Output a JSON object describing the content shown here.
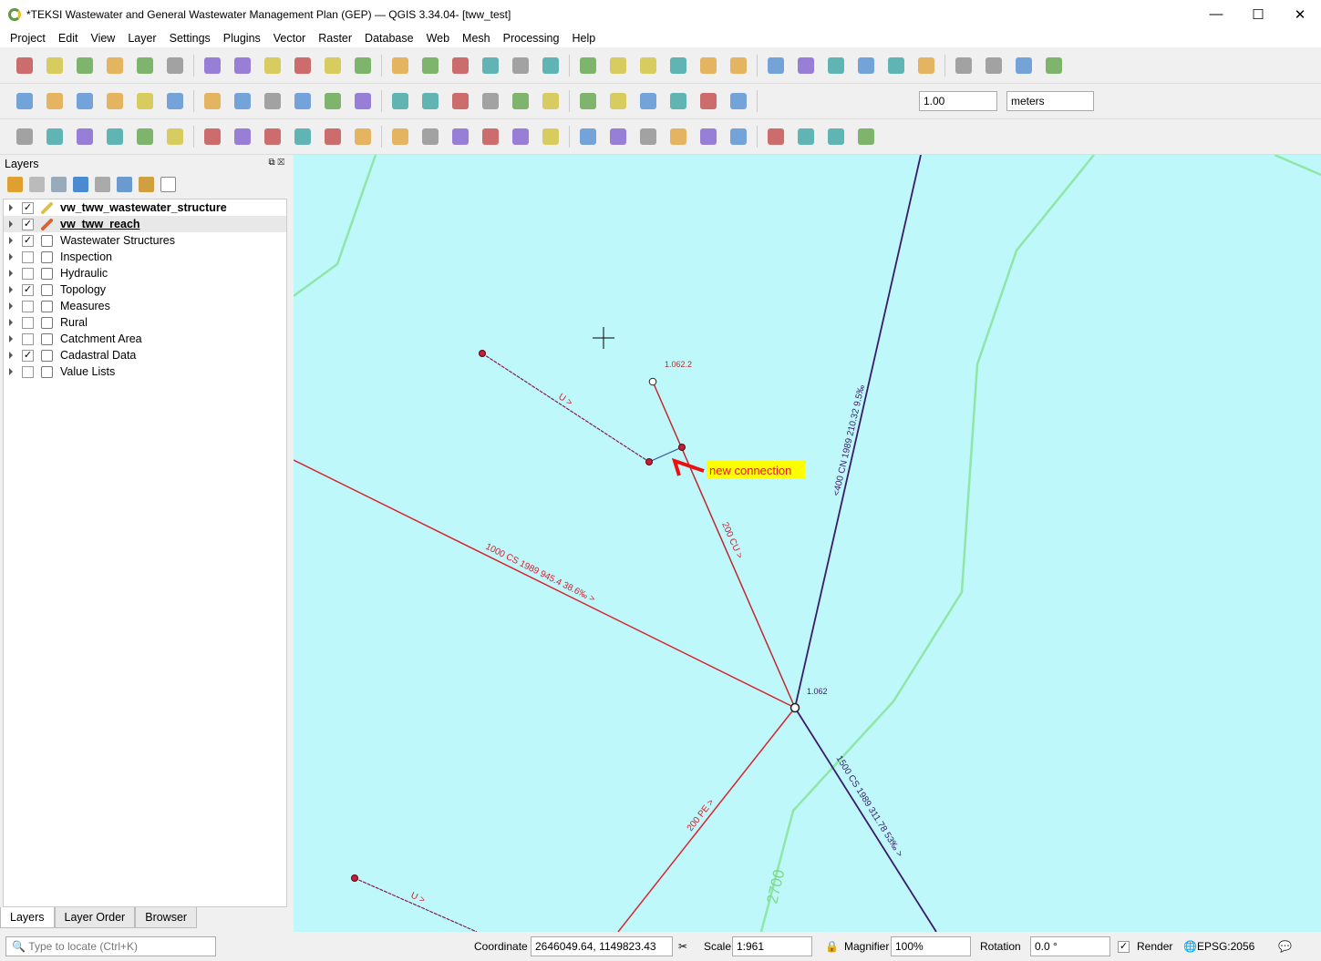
{
  "window": {
    "title": "*TEKSI Wastewater and General Wastewater Management Plan (GEP) — QGIS 3.34.04- [tww_test]",
    "minimize": "—",
    "maximize": "☐",
    "close": "✕"
  },
  "menu": [
    "Project",
    "Edit",
    "View",
    "Layer",
    "Settings",
    "Plugins",
    "Vector",
    "Raster",
    "Database",
    "Web",
    "Mesh",
    "Processing",
    "Help"
  ],
  "toolbar1": [
    "new-project",
    "open-project",
    "save-project",
    "new-print-layout",
    "layout-manager",
    "style-manager",
    "pan",
    "pan-to-selection",
    "zoom-in",
    "zoom-out",
    "zoom-full",
    "zoom-to-selection",
    "zoom-to-layer",
    "zoom-native",
    "zoom-last",
    "zoom-next",
    "new-map-view",
    "new-3d-view",
    "new-bookmark",
    "show-bookmarks",
    "temporal-controller",
    "refresh",
    "select-features",
    "select-by-expression",
    "deselect",
    "select-by-location",
    "identify",
    "attribute-table",
    "processing-toolbox",
    "statistics",
    "open-table",
    "measure",
    "map-tips",
    "locator"
  ],
  "toolbar2": [
    "digitize",
    "toggle-editing",
    "save-edits",
    "add-line",
    "vertex-tool",
    "modify-attributes",
    "delete-selected",
    "cut",
    "copy",
    "paste",
    "undo",
    "redo",
    "label-tool",
    "diagram",
    "pin-label",
    "show-hide-label",
    "move-label",
    "rotate-label",
    "change-label",
    "python-console",
    "help",
    "snapping-magnet",
    "snap-mode",
    "snap-vertex"
  ],
  "toolbar3": [
    "measure-line",
    "add-feature",
    "reshape",
    "split",
    "offset",
    "add-ring",
    "fill-ring",
    "add-part",
    "delete-ring",
    "delete-part",
    "merge",
    "simplify",
    "vertex-editor",
    "align",
    "split-parts",
    "rotate",
    "scale",
    "trim",
    "db-manager",
    "layer-select",
    "db-style",
    "tww-wizard",
    "tww-profile",
    "tww-network",
    "sql",
    "tww-connect",
    "tww-flow",
    "tww-trace"
  ],
  "snapping": {
    "tolerance": "1.00",
    "units": "meters"
  },
  "layers_panel": {
    "title": "Layers",
    "items": [
      {
        "name": "vw_tww_wastewater_structure",
        "checked": true,
        "icon": "pencil-icon",
        "bold": true
      },
      {
        "name": "vw_tww_reach",
        "checked": true,
        "icon": "pencil-icon",
        "bold": true
      },
      {
        "name": "Wastewater Structures",
        "checked": true,
        "icon": "group-icon"
      },
      {
        "name": "Inspection",
        "checked": false,
        "icon": "group-icon"
      },
      {
        "name": "Hydraulic",
        "checked": false,
        "icon": "group-icon"
      },
      {
        "name": "Topology",
        "checked": true,
        "icon": "group-icon"
      },
      {
        "name": "Measures",
        "checked": false,
        "icon": "group-icon"
      },
      {
        "name": "Rural",
        "checked": false,
        "icon": "group-icon"
      },
      {
        "name": "Catchment Area",
        "checked": false,
        "icon": "group-icon"
      },
      {
        "name": "Cadastral Data",
        "checked": true,
        "icon": "group-icon"
      },
      {
        "name": "Value Lists",
        "checked": false,
        "icon": "group-icon"
      }
    ]
  },
  "bottom_tabs": [
    "Layers",
    "Layer Order",
    "Browser"
  ],
  "map": {
    "labels": {
      "node_top": "1.062.2",
      "node_main": "1.062",
      "annotation": "new connection",
      "reach_u1": "U >",
      "reach_u2": "U >",
      "reach_200cu": "200 CU >",
      "reach_400": "<400 CN 1989 210.32 9.5‰",
      "reach_1000": "1000 CS 1989 945.4 38.6‰  >",
      "reach_1500": "1500 CS 1989 311.78 53‰  >",
      "reach_200pe": "200 PE >",
      "contour": "2700"
    },
    "colors": {
      "background": "#bff8fa",
      "reach_red": "#d7262f",
      "reach_purple": "#3a1a6a",
      "contour": "#8fe6a8",
      "annotation_bg": "#ffff00",
      "connection": "#3050a0"
    }
  },
  "statusbar": {
    "locate_placeholder": "Type to locate (Ctrl+K)",
    "coordinate_label": "Coordinate",
    "coordinate": "2646049.64, 1149823.43",
    "scale_label": "Scale",
    "scale": "1:961",
    "magnifier_label": "Magnifier",
    "magnifier": "100%",
    "rotation_label": "Rotation",
    "rotation": "0.0 °",
    "render_label": "Render",
    "render_checked": true,
    "crs": "EPSG:2056"
  }
}
